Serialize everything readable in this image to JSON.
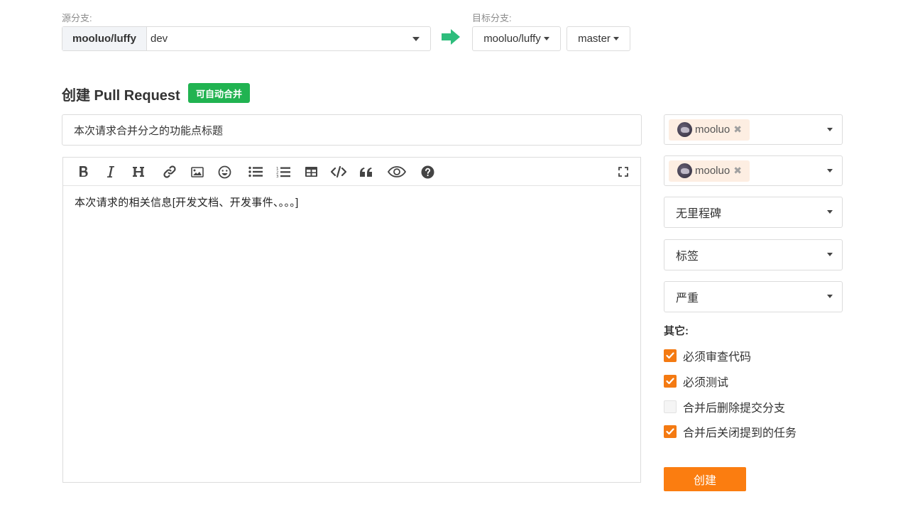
{
  "source": {
    "label": "源分支:",
    "repo": "mooluo/luffy",
    "branch": "dev"
  },
  "target": {
    "label": "目标分支:",
    "repo": "mooluo/luffy",
    "branch": "master"
  },
  "heading": {
    "title": "创建 Pull Request",
    "badge": "可自动合并"
  },
  "title_input": {
    "value": "本次请求合并分之的功能点标题"
  },
  "editor": {
    "toolbar": [
      "bold-icon",
      "italic-icon",
      "heading-icon",
      "link-icon",
      "image-icon",
      "emoji-icon",
      "unordered-list-icon",
      "ordered-list-icon",
      "table-icon",
      "code-icon",
      "quote-icon",
      "preview-icon",
      "help-icon",
      "fullscreen-icon"
    ],
    "content": "本次请求的相关信息[开发文档、开发事件、。。。]"
  },
  "sidebar": {
    "reviewers": {
      "user": "mooluo"
    },
    "testers": {
      "user": "mooluo"
    },
    "milestone": "无里程碑",
    "labels": "标签",
    "priority": "严重",
    "other_label": "其它:",
    "options": [
      {
        "label": "必须审查代码",
        "checked": true
      },
      {
        "label": "必须测试",
        "checked": true
      },
      {
        "label": "合并后删除提交分支",
        "checked": false
      },
      {
        "label": "合并后关闭提到的任务",
        "checked": true
      }
    ],
    "create_label": "创建"
  },
  "colors": {
    "accent": "#fb7d10",
    "badge": "#21b351",
    "arrow": "#2ebd7c"
  }
}
